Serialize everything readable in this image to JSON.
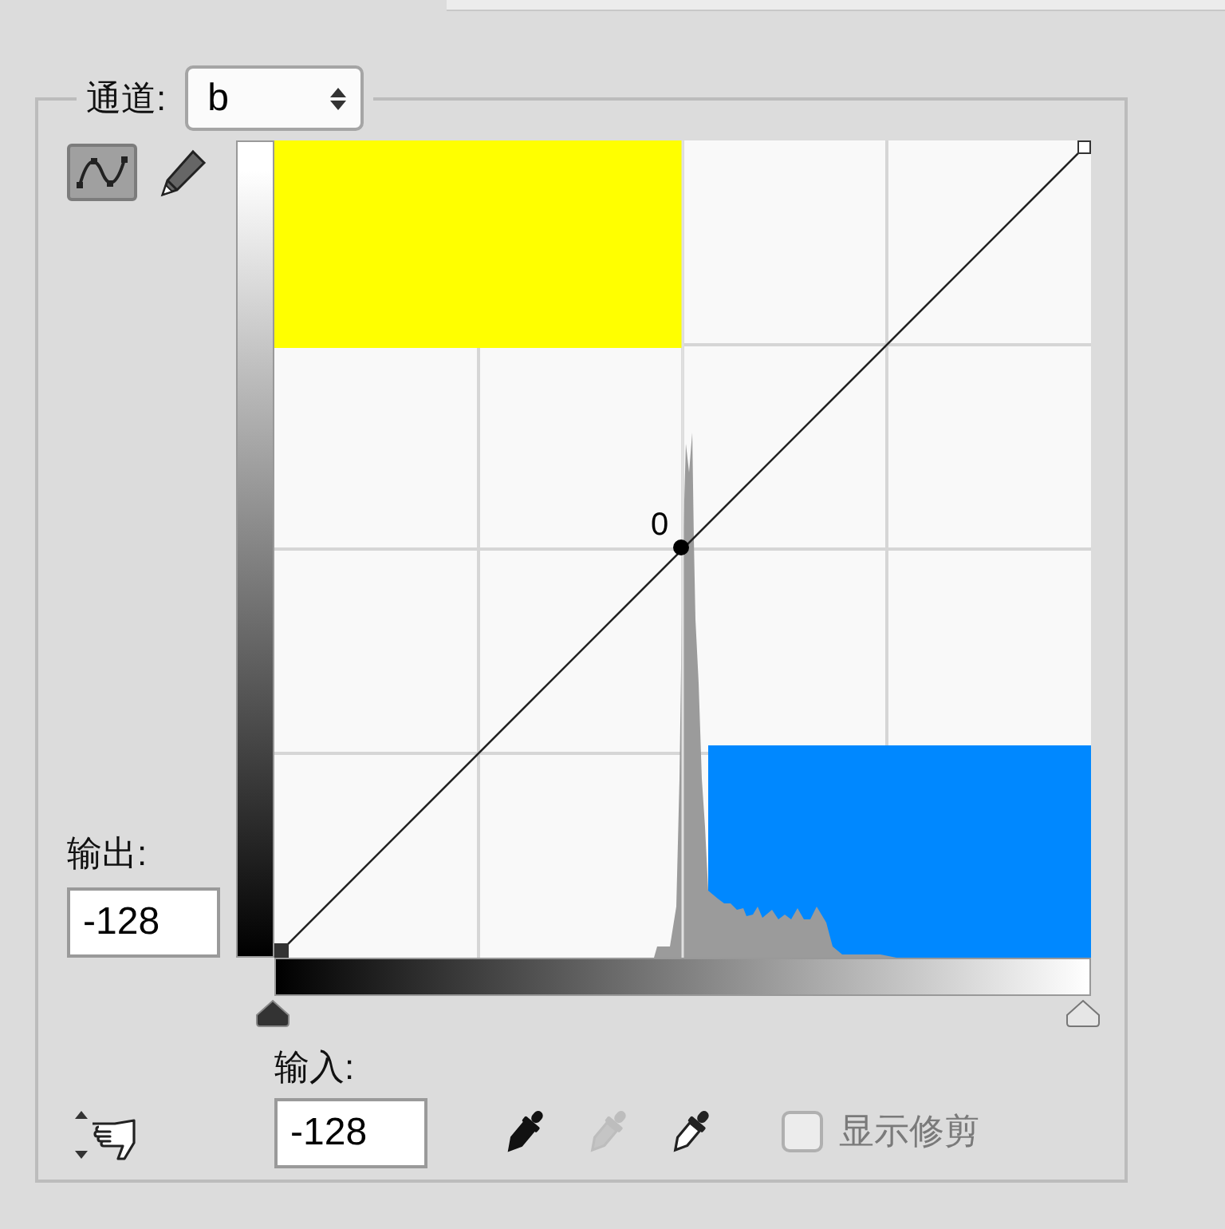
{
  "channel": {
    "label": "通道:",
    "value": "b"
  },
  "tools": [
    {
      "kind": "curve",
      "selected": true
    },
    {
      "kind": "pencil",
      "selected": false
    }
  ],
  "curve": {
    "point_label": "0"
  },
  "output": {
    "label": "输出:",
    "value": "-128"
  },
  "input": {
    "label": "输入:",
    "value": "-128"
  },
  "eyedroppers": [
    {
      "kind": "black",
      "disabled": false
    },
    {
      "kind": "gray",
      "disabled": true
    },
    {
      "kind": "white",
      "disabled": false
    }
  ],
  "show_clipping": {
    "label": "显示修剪",
    "checked": false
  }
}
